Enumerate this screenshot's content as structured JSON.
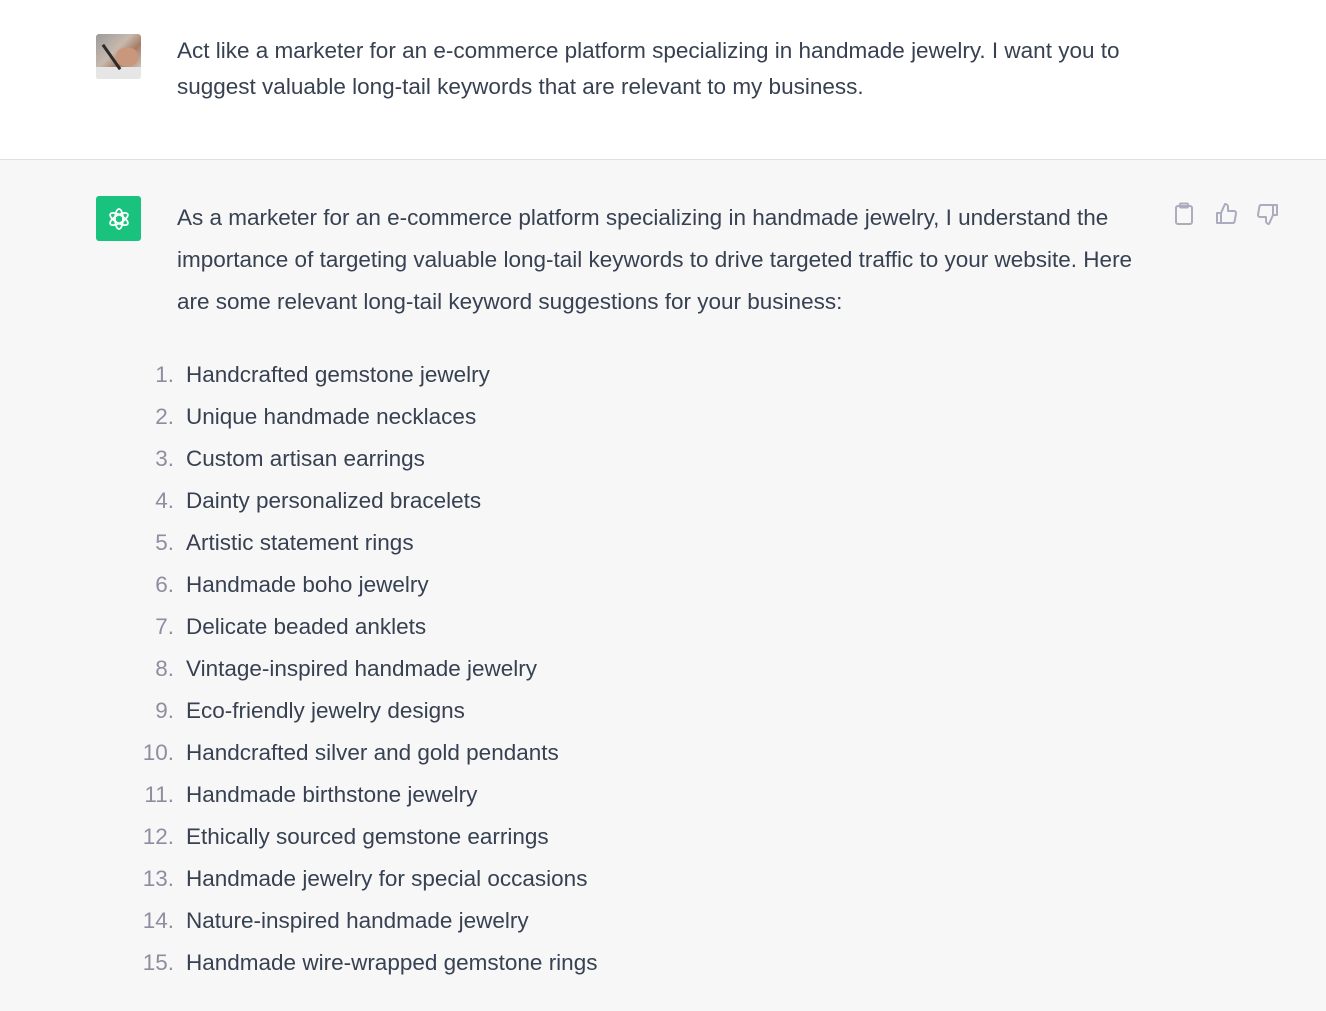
{
  "user_message": {
    "avatar": "user-photo-avatar",
    "text": "Act like a marketer for an e-commerce platform specializing in handmade jewelry. I want you to suggest valuable long-tail keywords that are relevant to my business."
  },
  "assistant_message": {
    "avatar": "openai-logo-icon",
    "accent_color": "#19c37d",
    "intro": "As a marketer for an e-commerce platform specializing in handmade jewelry, I understand the importance of targeting valuable long-tail keywords to drive targeted traffic to your website. Here are some relevant long-tail keyword suggestions for your business:",
    "actions": [
      {
        "name": "copy",
        "icon": "clipboard-icon"
      },
      {
        "name": "thumbs-up",
        "icon": "thumbs-up-icon"
      },
      {
        "name": "thumbs-down",
        "icon": "thumbs-down-icon"
      }
    ],
    "keywords": [
      {
        "num": "1.",
        "text": "Handcrafted gemstone jewelry"
      },
      {
        "num": "2.",
        "text": "Unique handmade necklaces"
      },
      {
        "num": "3.",
        "text": "Custom artisan earrings"
      },
      {
        "num": "4.",
        "text": "Dainty personalized bracelets"
      },
      {
        "num": "5.",
        "text": "Artistic statement rings"
      },
      {
        "num": "6.",
        "text": "Handmade boho jewelry"
      },
      {
        "num": "7.",
        "text": "Delicate beaded anklets"
      },
      {
        "num": "8.",
        "text": "Vintage-inspired handmade jewelry"
      },
      {
        "num": "9.",
        "text": "Eco-friendly jewelry designs"
      },
      {
        "num": "10.",
        "text": "Handcrafted silver and gold pendants"
      },
      {
        "num": "11.",
        "text": "Handmade birthstone jewelry"
      },
      {
        "num": "12.",
        "text": "Ethically sourced gemstone earrings"
      },
      {
        "num": "13.",
        "text": "Handmade jewelry for special occasions"
      },
      {
        "num": "14.",
        "text": "Nature-inspired handmade jewelry"
      },
      {
        "num": "15.",
        "text": "Handmade wire-wrapped gemstone rings"
      }
    ]
  }
}
